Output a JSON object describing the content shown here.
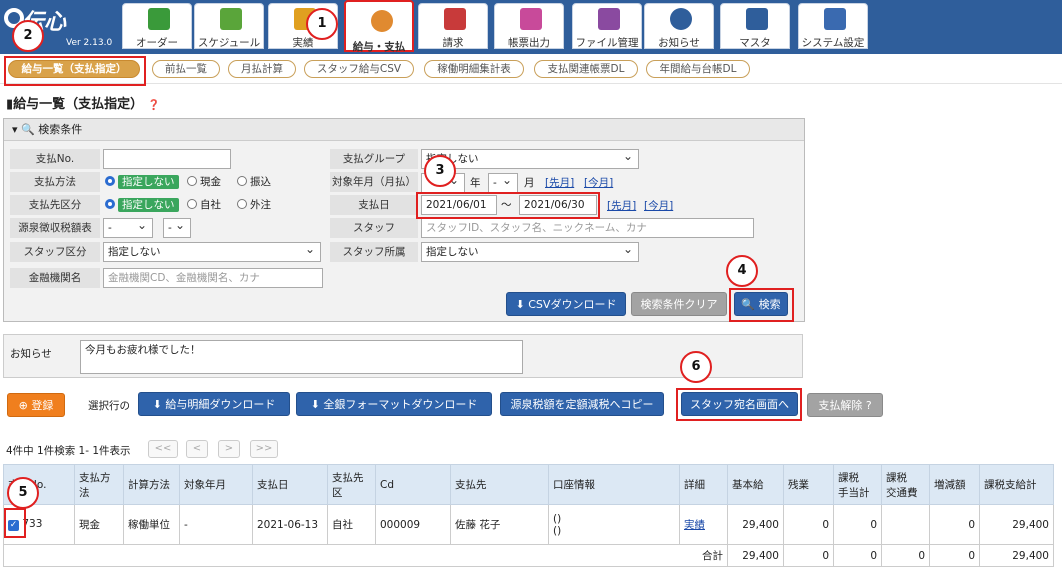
{
  "app": {
    "logo": "伝心",
    "version": "Ver 2.13.0"
  },
  "menu": [
    {
      "label": "オーダー",
      "icon": "handshake-icon"
    },
    {
      "label": "スケジュール",
      "icon": "calendar-icon"
    },
    {
      "label": "実績",
      "icon": "clipboard-icon"
    },
    {
      "label": "給与・支払",
      "icon": "payroll-person-icon"
    },
    {
      "label": "請求",
      "icon": "building-yen-icon"
    },
    {
      "label": "帳票出力",
      "icon": "stack-icon"
    },
    {
      "label": "ファイル管理",
      "icon": "folder-icon"
    },
    {
      "label": "お知らせ",
      "icon": "bell-icon"
    },
    {
      "label": "マスタ",
      "icon": "database-icon"
    },
    {
      "label": "システム設定",
      "icon": "settings-monitor-icon"
    }
  ],
  "subtabs": [
    "給与一覧（支払指定）",
    "前払一覧",
    "月払計算",
    "スタッフ給与CSV",
    "稼働明細集計表",
    "支払関連帳票DL",
    "年間給与台帳DL"
  ],
  "page_title": "給与一覧（支払指定）",
  "search": {
    "header": "検索条件",
    "labels": {
      "payno": "支払No.",
      "method": "支払方法",
      "dest": "支払先区分",
      "tax": "源泉徴収税額表",
      "staffkbn": "スタッフ区分",
      "bank": "金融機関名",
      "group": "支払グループ",
      "ym": "対象年月（月払）",
      "paydate": "支払日",
      "staff": "スタッフ",
      "affil": "スタッフ所属"
    },
    "method_opts": [
      "指定しない",
      "現金",
      "振込"
    ],
    "dest_opts": [
      "指定しない",
      "自社",
      "外注"
    ],
    "tax_sel1": "-",
    "tax_sel2": "-",
    "staffkbn_val": "指定しない",
    "bank_ph": "金融機関CD、金融機関名、カナ",
    "group_val": "指定しない",
    "ym_year_label": "年",
    "ym_month_val": "-",
    "ym_month_label": "月",
    "prev_month": "[先月]",
    "this_month": "[今月]",
    "date_from": "2021/06/01",
    "date_sep": "～",
    "date_to": "2021/06/30",
    "staff_ph": "スタッフID、スタッフ名、ニックネーム、カナ",
    "affil_val": "指定しない",
    "csv_btn": "CSVダウンロード",
    "clear_btn": "検索条件クリア",
    "search_btn": "検索"
  },
  "notice": {
    "label": "お知らせ",
    "text": "今月もお疲れ様でした！"
  },
  "actions": {
    "register": "登録",
    "selected_label": "選択行の",
    "pay_dl": "給与明細ダウンロード",
    "zengin_dl": "全銀フォーマットダウンロード",
    "tax_copy": "源泉税額を定額減税へコピー",
    "staff_addr": "スタッフ宛名画面へ",
    "cancel": "支払解除"
  },
  "paging": {
    "summary": "4件中 1件検索 1- 1件表示",
    "first": "<<",
    "prev": "<",
    "next": ">",
    "last": ">>"
  },
  "table": {
    "headers": [
      "支払No.",
      "支払方法",
      "計算方法",
      "対象年月",
      "支払日",
      "支払先区",
      "Cd",
      "支払先",
      "口座情報",
      "詳細",
      "基本給",
      "残業",
      "課税\n手当計",
      "課税\n交通費",
      "増減額",
      "課税支給計"
    ],
    "rows": [
      {
        "no": "733",
        "method": "現金",
        "calc": "稼働単位",
        "ym": "-",
        "date": "2021-06-13",
        "dest": "自社",
        "cd": "000009",
        "name": "佐藤 花子",
        "acct1": "()",
        "acct2": "()",
        "detail": "実績",
        "base": "29,400",
        "ot": "0",
        "allow": "0",
        "trans": "",
        "adj": "0",
        "total": "29,400"
      }
    ],
    "total": {
      "label": "合計",
      "base": "29,400",
      "ot": "0",
      "allow": "0",
      "trans": "0",
      "adj": "0",
      "total": "29,400"
    }
  },
  "markers": [
    "1",
    "2",
    "3",
    "4",
    "5",
    "6"
  ]
}
